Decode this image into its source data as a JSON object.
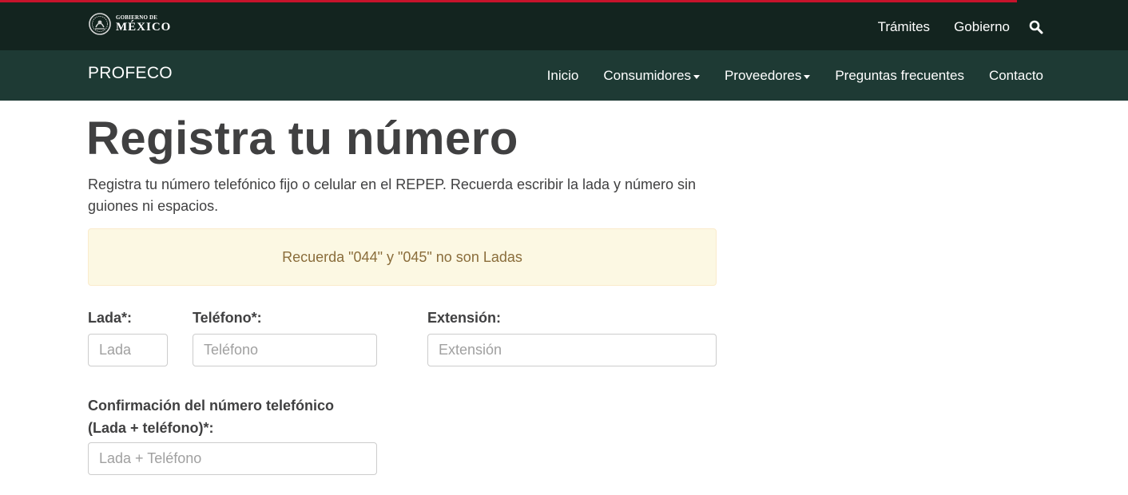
{
  "gov_header": {
    "logo_line1": "GOBIERNO DE",
    "logo_line2": "MÉXICO",
    "links": [
      "Trámites",
      "Gobierno"
    ],
    "search_icon": "search-icon"
  },
  "site_header": {
    "brand": "PROFECO",
    "nav": [
      {
        "label": "Inicio"
      },
      {
        "label": "Consumidores"
      },
      {
        "label": "Proveedores"
      },
      {
        "label": "Preguntas frecuentes"
      },
      {
        "label": "Contacto"
      }
    ]
  },
  "page": {
    "title": "Registra tu número",
    "intro": "Registra tu número telefónico fijo o celular en el REPEP. Recuerda escribir la lada y número sin guiones ni espacios.",
    "alert": "Recuerda \"044\" y \"045\" no son Ladas"
  },
  "form": {
    "lada_label": "Lada*:",
    "lada_placeholder": "Lada",
    "telefono_label": "Teléfono*:",
    "telefono_placeholder": "Teléfono",
    "extension_label": "Extensión:",
    "extension_placeholder": "Extensión",
    "confirm_label_line1": "Confirmación del número telefónico",
    "confirm_label_line2": "(Lada + teléfono)*:",
    "confirm_placeholder": "Lada + Teléfono"
  },
  "colors": {
    "gov_bar": "#13241f",
    "site_bar": "#1e3a34",
    "accent_red": "#c6132b",
    "alert_bg": "#fcf8e3",
    "alert_text": "#8a6d3b"
  }
}
